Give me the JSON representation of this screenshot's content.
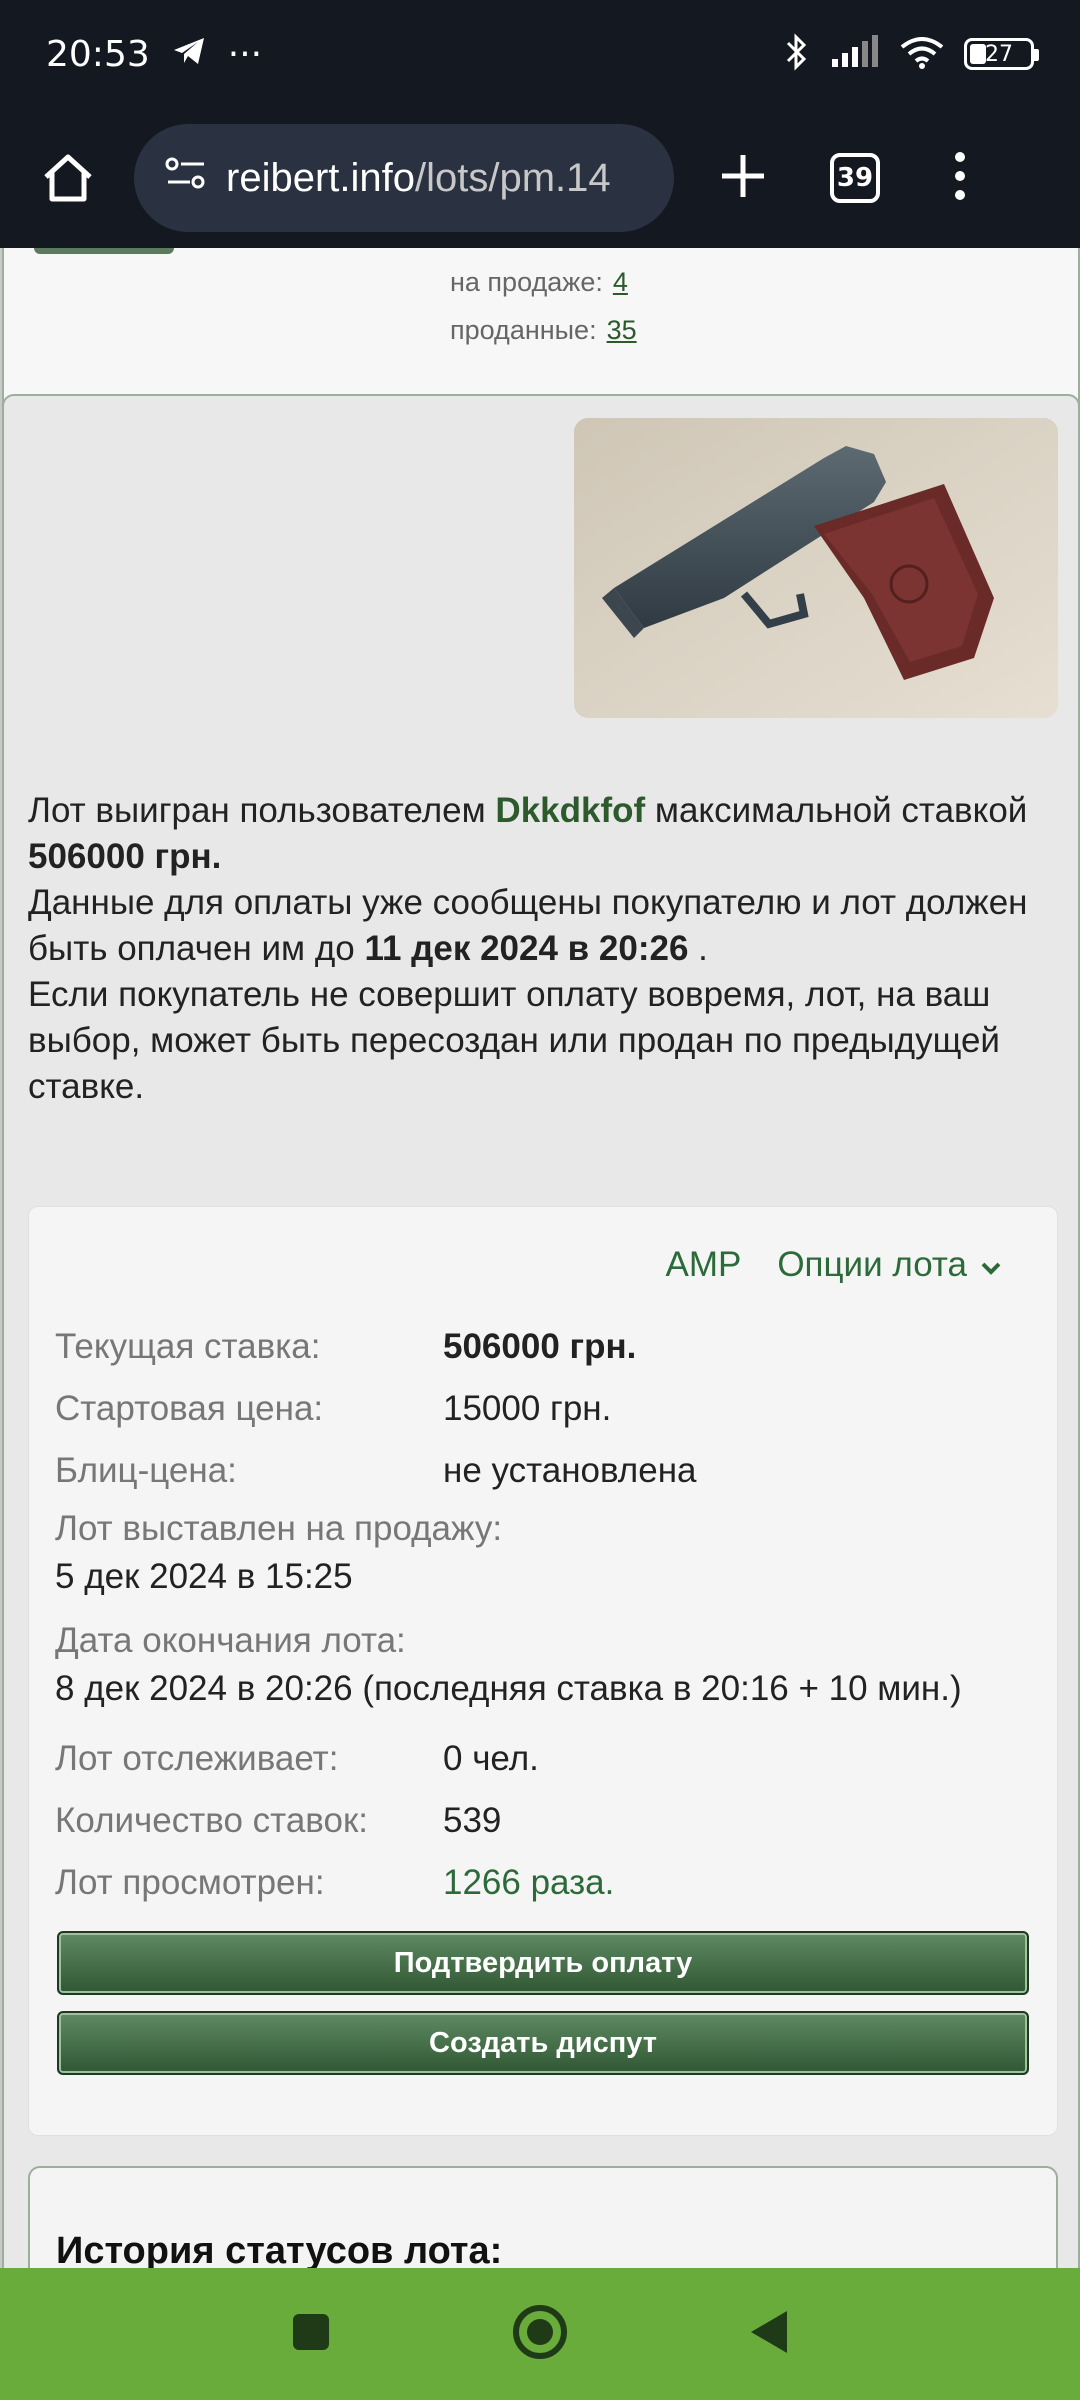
{
  "status_bar": {
    "time": "20:53",
    "dots": "···",
    "battery": "27",
    "icons": [
      "telegram-icon",
      "bluetooth-icon",
      "signal-icon",
      "wifi-icon",
      "battery-icon"
    ]
  },
  "browser": {
    "url_domain": "reibert.info",
    "url_path": "/lots/pm.14",
    "tab_count": "39",
    "icons": [
      "home-icon",
      "site-settings-icon",
      "new-tab-plus-icon",
      "tabs-icon",
      "more-vert-icon"
    ]
  },
  "seller": {
    "on_sale_label": "на продаже:",
    "on_sale_count": "4",
    "sold_label": "проданные:",
    "sold_count": "35"
  },
  "lot": {
    "image_alt": "pistol-photo",
    "text_1": "Лот выигран пользователем ",
    "winner": "Dkkdkfof",
    "text_2": " максимальной ставкой ",
    "winning_bid": "506000 грн.",
    "text_3": "Данные для оплаты уже сообщены покупателю и лот должен быть оплачен им до ",
    "pay_deadline": "11 дек 2024 в 20:26",
    "text_4": " .",
    "text_5": "Если покупатель не совершит оплату вовремя, лот, на ваш выбор, может быть пересоздан или продан по предыдущей ставке."
  },
  "info": {
    "amp_link": "AMP",
    "options_link": "Опции лота",
    "current_bid_label": "Текущая ставка:",
    "current_bid_value": "506000 грн.",
    "start_price_label": "Стартовая цена:",
    "start_price_value": "15000 грн.",
    "blitz_label": "Блиц-цена:",
    "blitz_value": "не установлена",
    "listed_label": "Лот выставлен на продажу:",
    "listed_value": "5 дек 2024 в 15:25",
    "end_label": "Дата окончания лота:",
    "end_value": "8 дек 2024 в 20:26 (последняя ставка в 20:16 + 10 мин.)",
    "watchers_label": "Лот отслеживает:",
    "watchers_value": "0 чел.",
    "bids_label": "Количество ставок:",
    "bids_value": "539",
    "views_label": "Лот просмотрен:",
    "views_value": "1266 раза.",
    "confirm_button": "Подтвердить оплату",
    "dispute_button": "Создать диспут"
  },
  "history": {
    "title": "История статусов лота:"
  },
  "colors": {
    "accent_green": "#2d6a3a",
    "nav_bar": "#6aac3b",
    "status_bar": "#141820"
  }
}
